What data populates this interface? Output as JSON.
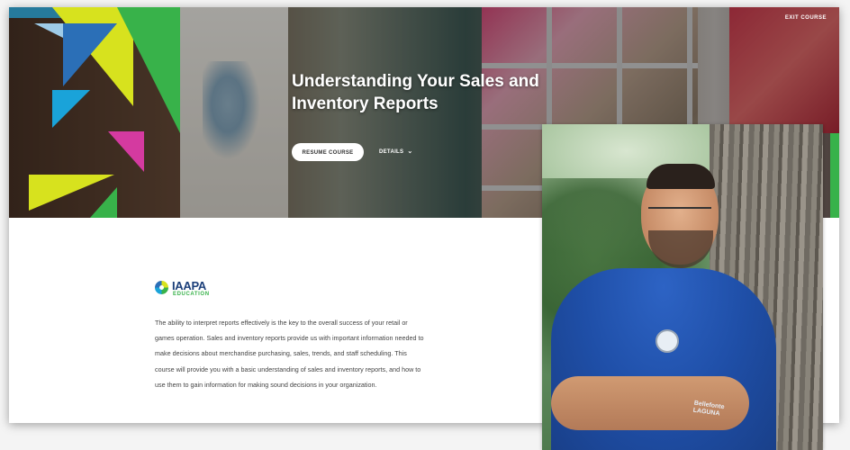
{
  "header": {
    "exit_label": "EXIT COURSE"
  },
  "hero": {
    "title": "Understanding Your Sales and Inventory Reports",
    "resume_button": "RESUME COURSE",
    "details_button": "DETAILS"
  },
  "brand": {
    "name": "IAAPA",
    "sub": "EDUCATION",
    "colors": {
      "navy": "#1b3f7a",
      "green": "#38b24a",
      "yellow": "#d7e21e",
      "cyan": "#1aa3d9",
      "magenta": "#d43aa0"
    }
  },
  "course": {
    "description": "The ability to interpret reports effectively is the key to the overall success of your retail or games operation. Sales and inventory reports provide us with important information needed to make decisions about merchandise purchasing, sales, trends, and staff scheduling. This course will provide you with a basic understanding of sales and inventory reports, and how to use them to gain information for making sound decisions in your organization."
  },
  "photo": {
    "shirt_text": "Bellefonte LAGUNA"
  }
}
